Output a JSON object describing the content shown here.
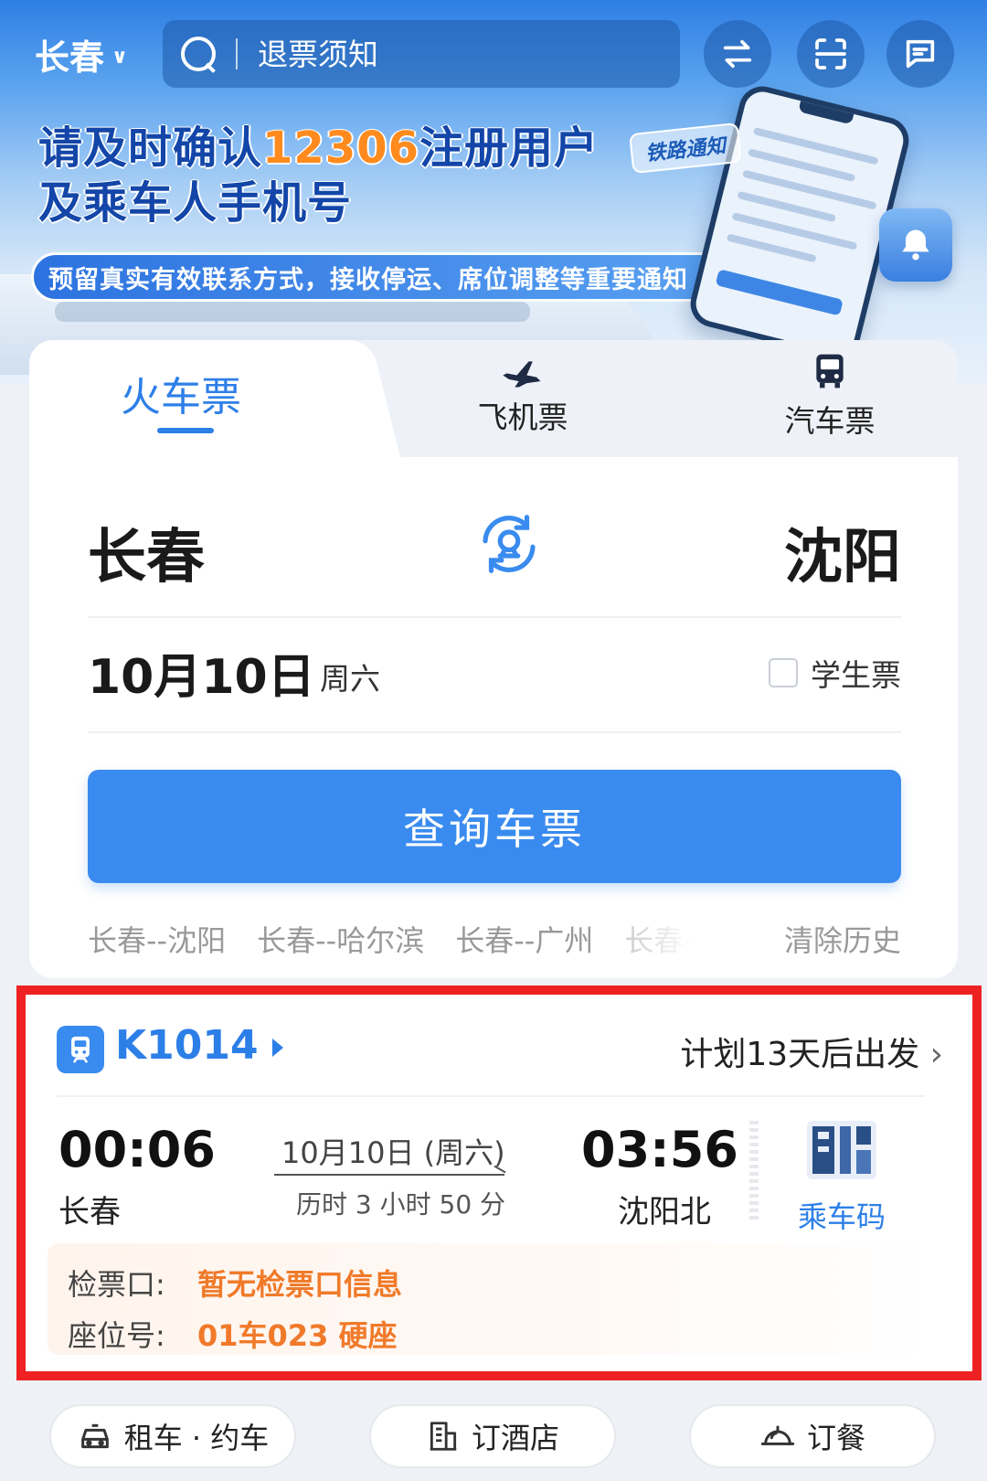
{
  "topbar": {
    "city": "长春",
    "search_placeholder": "退票须知"
  },
  "banner": {
    "title_line1_pre": "请及时确认",
    "title_line1_hl": "12306",
    "title_line1_post": "注册用户",
    "title_line2": "及乘车人手机号",
    "subtitle": "预留真实有效联系方式，接收停运、席位调整等重要通知",
    "tag": "铁路通知"
  },
  "tabs": [
    {
      "label": "火车票",
      "active": true
    },
    {
      "label": "飞机票",
      "active": false
    },
    {
      "label": "汽车票",
      "active": false
    }
  ],
  "search": {
    "from": "长春",
    "to": "沈阳",
    "date": "10月10日",
    "weekday": "周六",
    "student_label": "学生票",
    "query_label": "查询车票"
  },
  "history": {
    "items": [
      "长春--沈阳",
      "长春--哈尔滨",
      "长春--广州",
      "长春-"
    ],
    "clear_label": "清除历史"
  },
  "trip": {
    "train_no": "K1014",
    "plan": "计划13天后出发",
    "dep_time": "00:06",
    "dep_station": "长春",
    "arr_time": "03:56",
    "arr_station": "沈阳北",
    "date": "10月10日 (周六)",
    "duration": "历时 3 小时 50 分",
    "qr_label": "乘车码",
    "gate_label": "检票口:",
    "gate_value": "暂无检票口信息",
    "seat_label": "座位号:",
    "seat_value": "01车023 硬座"
  },
  "services": [
    {
      "label": "租车 · 约车",
      "icon": "car-icon"
    },
    {
      "label": "订酒店",
      "icon": "hotel-icon"
    },
    {
      "label": "订餐",
      "icon": "food-cloche-icon"
    }
  ],
  "colors": {
    "accent": "#3a8bef",
    "accent_text": "#2d7fe8",
    "orange": "#f07a2a",
    "highlight_frame": "#ee2222"
  }
}
